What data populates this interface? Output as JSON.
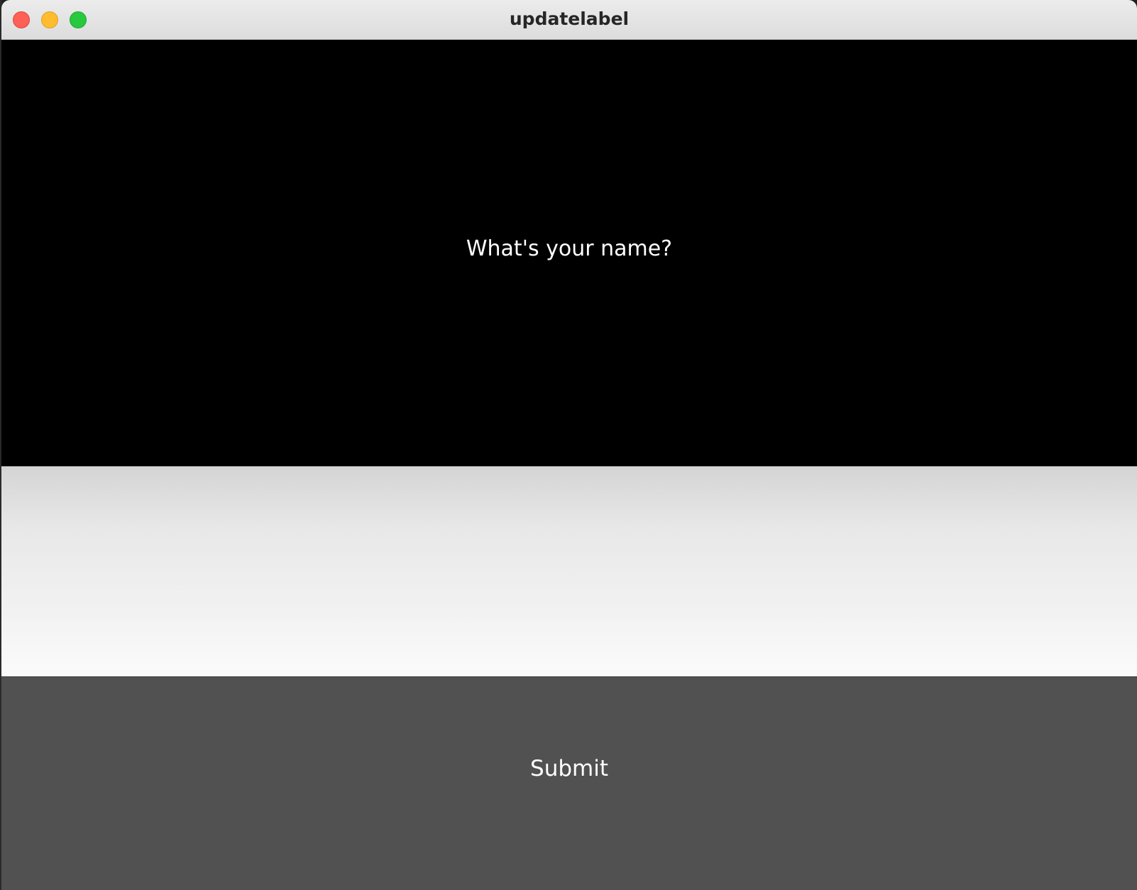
{
  "window": {
    "title": "updatelabel",
    "controls": [
      "close",
      "minimize",
      "maximize"
    ]
  },
  "label": {
    "text": "What's your name?",
    "background_color": "#000000",
    "text_color": "#ffffff"
  },
  "text_input": {
    "value": "",
    "placeholder": ""
  },
  "submit_button": {
    "label": "Submit",
    "background_color": "#515151",
    "text_color": "#ffffff"
  }
}
